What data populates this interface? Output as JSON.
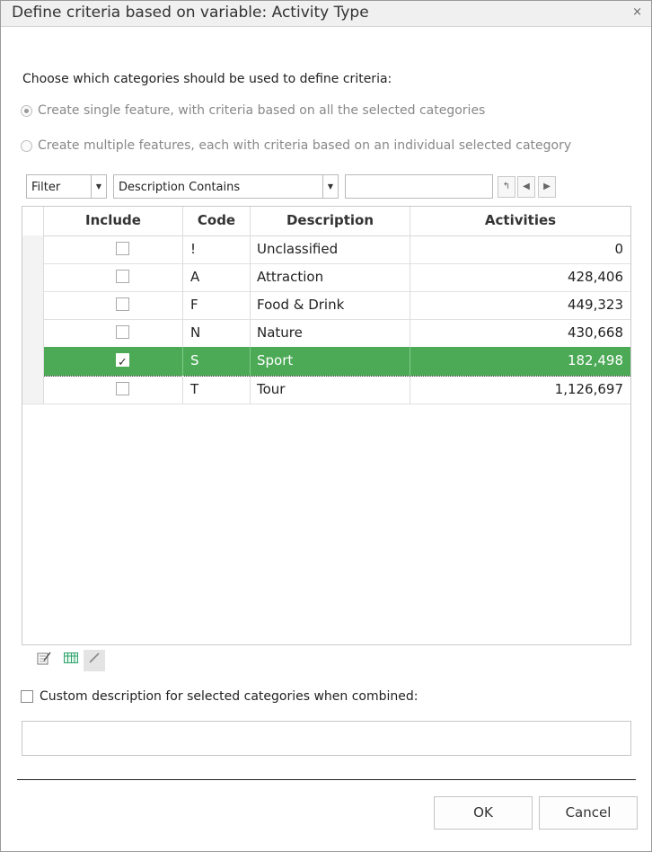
{
  "window": {
    "title": "Define criteria based on variable: Activity Type",
    "close_glyph": "×"
  },
  "instruction": "Choose which categories should be used to define criteria:",
  "radio_options": [
    {
      "label": "Create single feature, with criteria based on all the selected categories",
      "selected": true
    },
    {
      "label": "Create multiple features, each with criteria based on an individual selected category",
      "selected": false
    }
  ],
  "filter": {
    "mode": "Filter",
    "field": "Description Contains",
    "search_value": ""
  },
  "grid": {
    "columns": [
      "Include",
      "Code",
      "Description",
      "Activities"
    ],
    "rows": [
      {
        "include": false,
        "code": "!",
        "description": "Unclassified",
        "activities": "0"
      },
      {
        "include": false,
        "code": "A",
        "description": "Attraction",
        "activities": "428,406"
      },
      {
        "include": false,
        "code": "F",
        "description": "Food & Drink",
        "activities": "449,323"
      },
      {
        "include": false,
        "code": "N",
        "description": "Nature",
        "activities": "430,668"
      },
      {
        "include": true,
        "code": "S",
        "description": "Sport",
        "activities": "182,498"
      },
      {
        "include": false,
        "code": "T",
        "description": "Tour",
        "activities": "1,126,697"
      }
    ],
    "selected_row_color": "#4caa57"
  },
  "grid_tools": [
    "edit-list-icon",
    "grid-columns-icon",
    "pencil-icon"
  ],
  "custom": {
    "label": "Custom description for selected categories when combined:",
    "checked": false,
    "value": ""
  },
  "buttons": {
    "ok": "OK",
    "cancel": "Cancel"
  }
}
